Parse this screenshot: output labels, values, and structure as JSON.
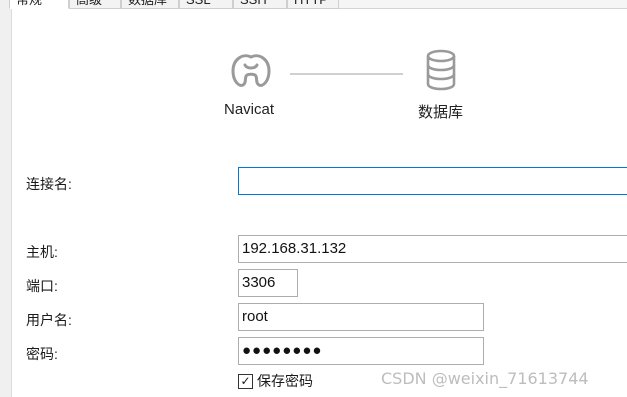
{
  "tabs": [
    {
      "label": "常规",
      "active": true
    },
    {
      "label": "高级",
      "active": false
    },
    {
      "label": "数据库",
      "active": false
    },
    {
      "label": "SSL",
      "active": false
    },
    {
      "label": "SSH",
      "active": false
    },
    {
      "label": "HTTP",
      "active": false
    }
  ],
  "steps": {
    "source_label": "Navicat",
    "source_icon": "navicat-logo-icon",
    "target_label": "数据库",
    "target_icon": "database-icon"
  },
  "form": {
    "connection_name": {
      "label": "连接名:",
      "value": ""
    },
    "host": {
      "label": "主机:",
      "value": "192.168.31.132"
    },
    "port": {
      "label": "端口:",
      "value": "3306"
    },
    "username": {
      "label": "用户名:",
      "value": "root"
    },
    "password": {
      "label": "密码:",
      "value": "●●●●●●●●"
    },
    "save_password": {
      "label": "保存密码",
      "checked": true,
      "check_glyph": "✓"
    }
  },
  "watermark": "CSDN @weixin_71613744",
  "colors": {
    "focus": "#0078d7",
    "icon": "#9a9a9a",
    "watermark": "#bdbdbd"
  }
}
